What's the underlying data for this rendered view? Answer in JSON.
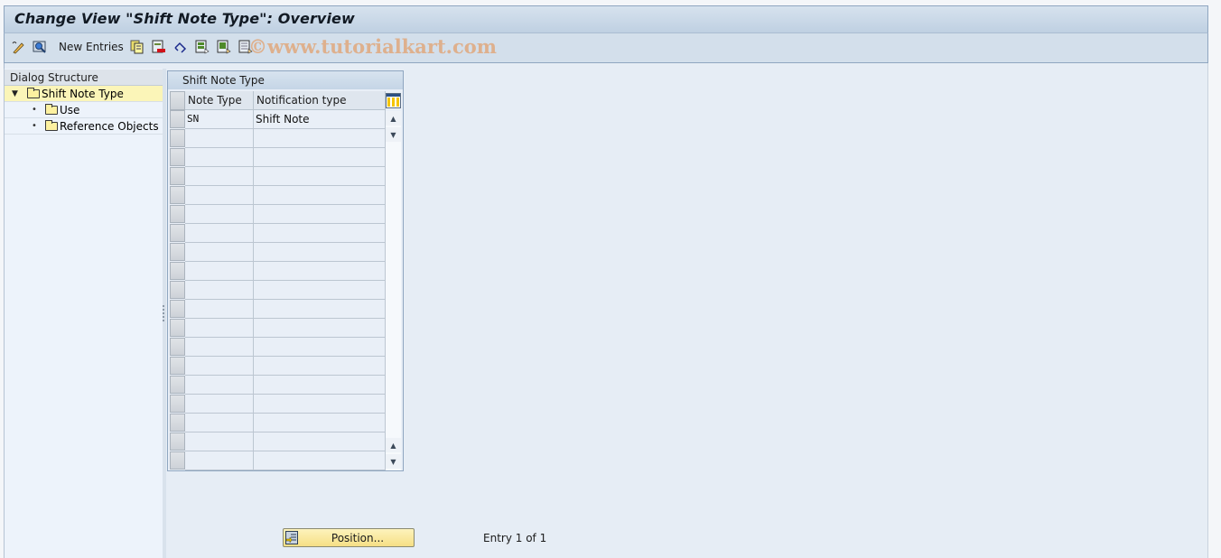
{
  "window": {
    "title": "Change View \"Shift Note Type\": Overview"
  },
  "toolbar": {
    "new_entries_label": "New Entries",
    "icons": [
      "display-change-icon",
      "other-view-icon",
      "copy-as-icon",
      "delete-icon",
      "undo-change-icon",
      "select-all-icon",
      "select-block-icon",
      "deselect-all-icon"
    ],
    "watermark": "©www.tutorialkart.com"
  },
  "dialog_structure": {
    "header": "Dialog Structure",
    "items": [
      {
        "label": "Shift Note Type",
        "level": 0,
        "expanded": true,
        "selected": true
      },
      {
        "label": "Use",
        "level": 1,
        "expanded": false,
        "selected": false
      },
      {
        "label": "Reference Objects",
        "level": 1,
        "expanded": false,
        "selected": false
      }
    ]
  },
  "table": {
    "title": "Shift Note Type",
    "columns": [
      "Note Type",
      "Notification type"
    ],
    "rows": [
      [
        "SN",
        "Shift Note"
      ]
    ],
    "visible_row_count": 19
  },
  "footer": {
    "position_label": "Position...",
    "entry_info": "Entry 1 of 1"
  }
}
